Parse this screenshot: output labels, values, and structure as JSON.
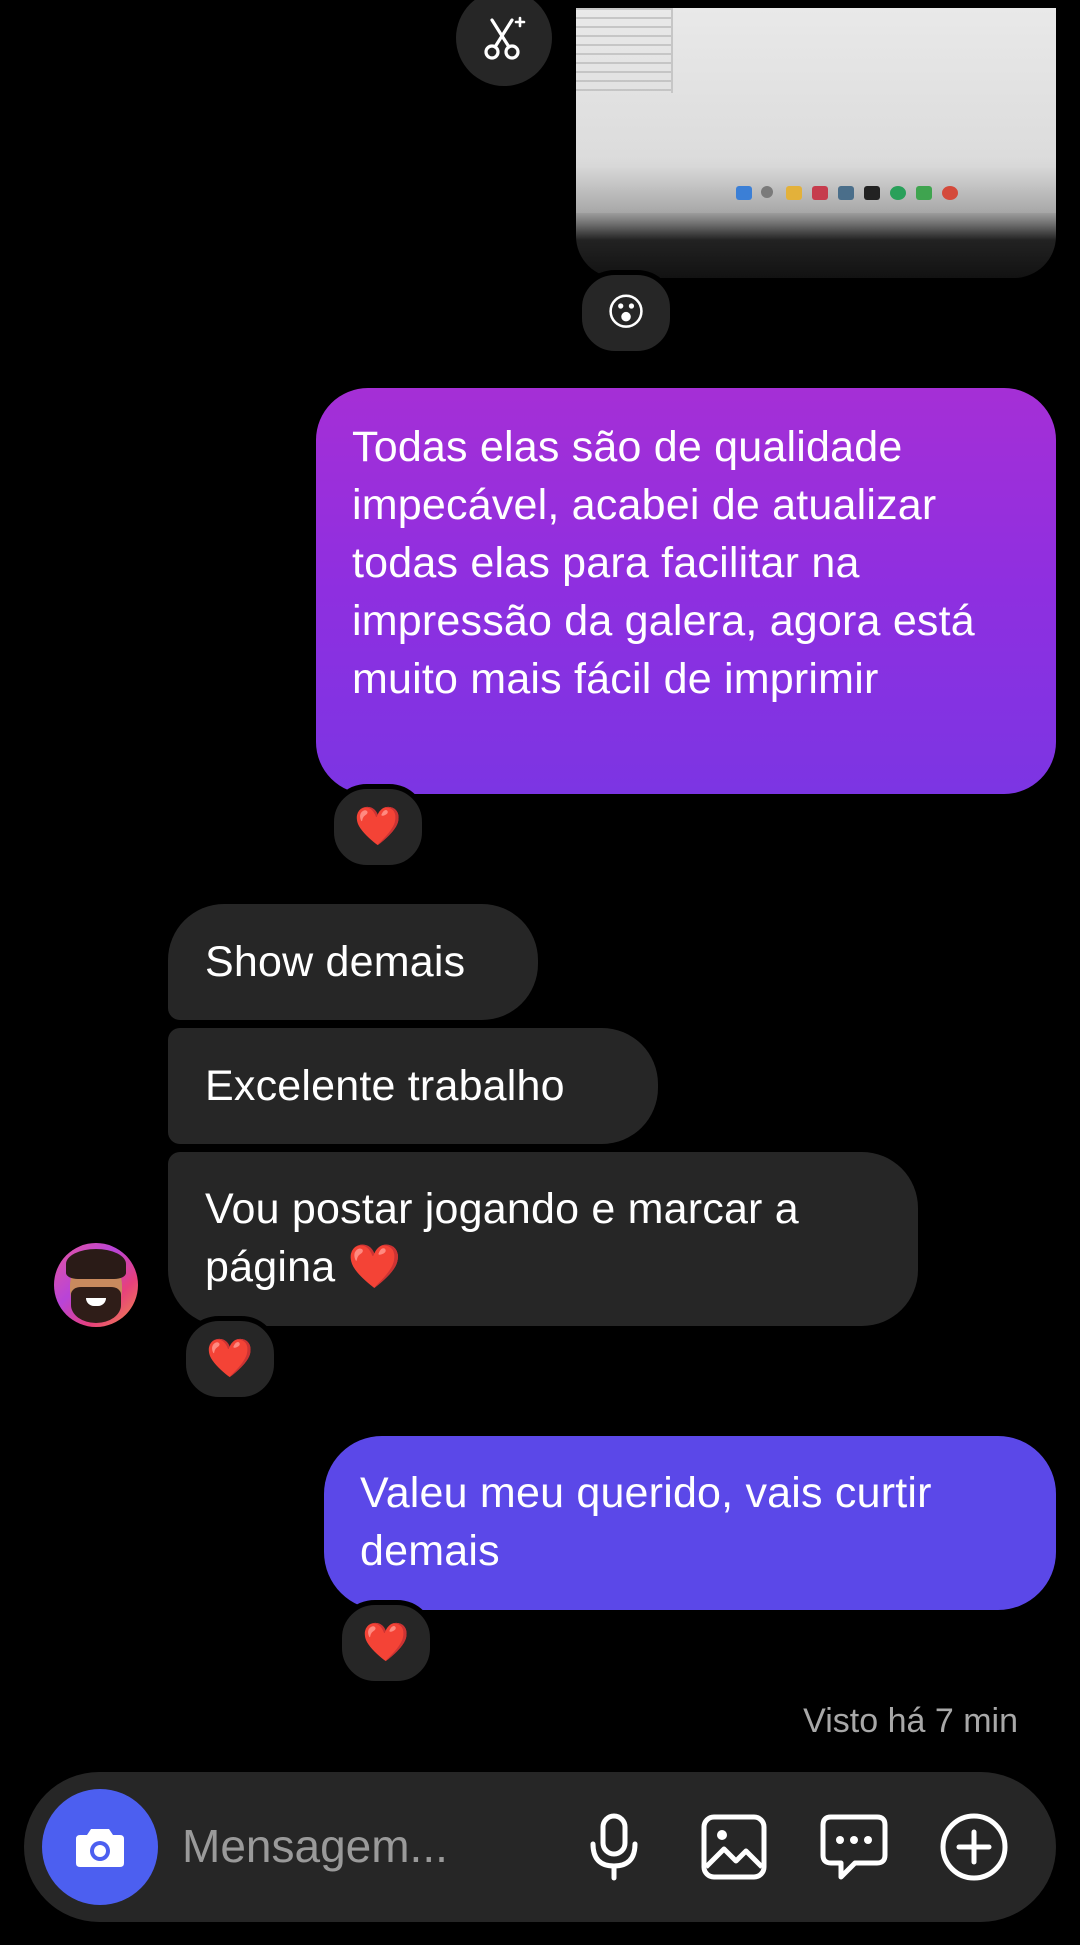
{
  "messages": [
    {
      "id": "photo",
      "direction": "incoming",
      "type": "image",
      "reaction": "😮"
    },
    {
      "id": "out1",
      "direction": "outgoing",
      "text": "Todas elas são de qualidade impecável, acabei de atualizar todas elas para facilitar na impressão da galera, agora está muito mais fácil de imprimir",
      "reaction": "❤️"
    },
    {
      "id": "in1",
      "direction": "incoming",
      "text": "Show demais"
    },
    {
      "id": "in2",
      "direction": "incoming",
      "text": "Excelente trabalho"
    },
    {
      "id": "in3",
      "direction": "incoming",
      "text": "Vou postar jogando e marcar a página",
      "emoji": "❤️",
      "reaction": "❤️"
    },
    {
      "id": "out2",
      "direction": "outgoing",
      "text": "Valeu meu querido, vais curtir demais",
      "reaction": "❤️"
    }
  ],
  "seen_status": "Visto há 7 min",
  "composer": {
    "placeholder": "Mensagem...",
    "icons": [
      "camera-icon",
      "microphone-icon",
      "gallery-icon",
      "sticker-chat-icon",
      "add-icon"
    ]
  },
  "colors": {
    "background": "#000000",
    "incoming_bubble": "#262626",
    "outgoing_gradient_top": "#a52fd6",
    "outgoing_gradient_bottom": "#7c35e3",
    "outgoing_latest": "#5b48e8",
    "camera_button": "#4c5ff0"
  }
}
